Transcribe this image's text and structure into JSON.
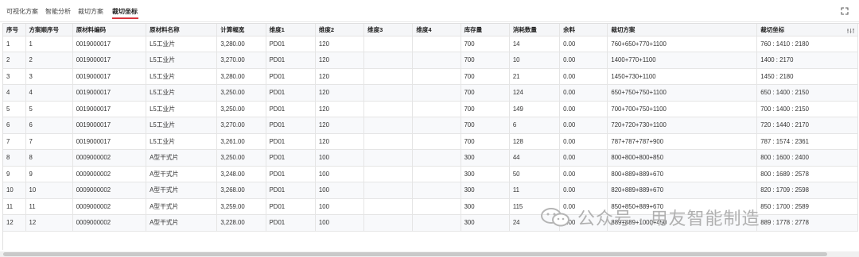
{
  "tabs": [
    {
      "label": "可视化方案"
    },
    {
      "label": "智能分析"
    },
    {
      "label": "裁切方案"
    },
    {
      "label": "裁切坐标"
    }
  ],
  "active_tab": "裁切坐标",
  "accent_color": "#d9363e",
  "table": {
    "columns": [
      "序号",
      "方案顺序号",
      "原材料编码",
      "原材料名称",
      "计算幅宽",
      "维度1",
      "维度2",
      "维度3",
      "维度4",
      "库存量",
      "消耗数量",
      "余料",
      "裁切方案",
      "裁切坐标"
    ],
    "rows": [
      [
        "1",
        "1",
        "0019000017",
        "L5工业片",
        "3,280.00",
        "PD01",
        "120",
        "",
        "",
        "700",
        "14",
        "0.00",
        "760+650+770+1100",
        "760 : 1410 : 2180"
      ],
      [
        "2",
        "2",
        "0019000017",
        "L5工业片",
        "3,270.00",
        "PD01",
        "120",
        "",
        "",
        "700",
        "10",
        "0.00",
        "1400+770+1100",
        "1400 : 2170"
      ],
      [
        "3",
        "3",
        "0019000017",
        "L5工业片",
        "3,280.00",
        "PD01",
        "120",
        "",
        "",
        "700",
        "21",
        "0.00",
        "1450+730+1100",
        "1450 : 2180"
      ],
      [
        "4",
        "4",
        "0019000017",
        "L5工业片",
        "3,250.00",
        "PD01",
        "120",
        "",
        "",
        "700",
        "124",
        "0.00",
        "650+750+750+1100",
        "650 : 1400 : 2150"
      ],
      [
        "5",
        "5",
        "0019000017",
        "L5工业片",
        "3,250.00",
        "PD01",
        "120",
        "",
        "",
        "700",
        "149",
        "0.00",
        "700+700+750+1100",
        "700 : 1400 : 2150"
      ],
      [
        "6",
        "6",
        "0019000017",
        "L5工业片",
        "3,270.00",
        "PD01",
        "120",
        "",
        "",
        "700",
        "6",
        "0.00",
        "720+720+730+1100",
        "720 : 1440 : 2170"
      ],
      [
        "7",
        "7",
        "0019000017",
        "L5工业片",
        "3,261.00",
        "PD01",
        "120",
        "",
        "",
        "700",
        "128",
        "0.00",
        "787+787+787+900",
        "787 : 1574 : 2361"
      ],
      [
        "8",
        "8",
        "0009000002",
        "A型干式片",
        "3,250.00",
        "PD01",
        "100",
        "",
        "",
        "300",
        "44",
        "0.00",
        "800+800+800+850",
        "800 : 1600 : 2400"
      ],
      [
        "9",
        "9",
        "0009000002",
        "A型干式片",
        "3,248.00",
        "PD01",
        "100",
        "",
        "",
        "300",
        "50",
        "0.00",
        "800+889+889+670",
        "800 : 1689 : 2578"
      ],
      [
        "10",
        "10",
        "0009000002",
        "A型干式片",
        "3,268.00",
        "PD01",
        "100",
        "",
        "",
        "300",
        "11",
        "0.00",
        "820+889+889+670",
        "820 : 1709 : 2598"
      ],
      [
        "11",
        "11",
        "0009000002",
        "A型干式片",
        "3,259.00",
        "PD01",
        "100",
        "",
        "",
        "300",
        "115",
        "0.00",
        "850+850+889+670",
        "850 : 1700 : 2589"
      ],
      [
        "12",
        "12",
        "0009000002",
        "A型干式片",
        "3,228.00",
        "PD01",
        "100",
        "",
        "",
        "300",
        "24",
        "0.00",
        "889+889+1000+450",
        "889 : 1778 : 2778"
      ]
    ]
  },
  "watermark": "公众号 · 用友智能制造",
  "icons": {
    "expand": "fullscreen-expand-icon",
    "column_settings": "column-settings-icon",
    "watermark_logo": "wechat-logo-icon"
  }
}
